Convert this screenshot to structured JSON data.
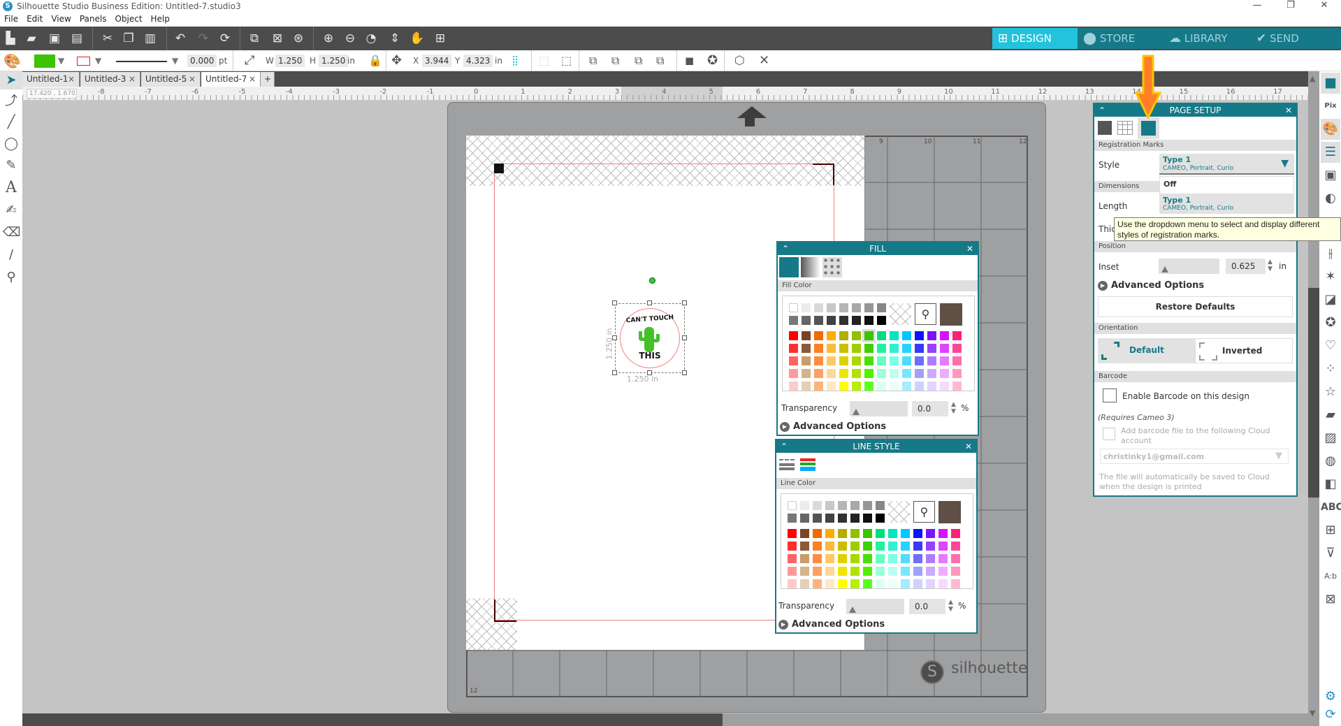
{
  "window": {
    "title": "Silhouette Studio Business Edition: Untitled-7.studio3",
    "controls": {
      "minimize": "—",
      "restore": "❐",
      "close": "✕"
    }
  },
  "menu": [
    "File",
    "Edit",
    "View",
    "Panels",
    "Object",
    "Help"
  ],
  "toolbar": {
    "icons": [
      "new-file",
      "open-folder",
      "save",
      "print",
      "cut",
      "copy",
      "paste",
      "undo",
      "redo",
      "replicate",
      "group",
      "ungroup",
      "fill-group",
      "zoom-in",
      "zoom-out",
      "zoom-select",
      "pan-drag",
      "hand",
      "fit-to-page"
    ],
    "nav_tabs": [
      {
        "label": "DESIGN",
        "icon": "grid-icon",
        "active": true
      },
      {
        "label": "STORE",
        "icon": "store-icon",
        "active": false
      },
      {
        "label": "LIBRARY",
        "icon": "cloud-download-icon",
        "active": false
      },
      {
        "label": "SEND",
        "icon": "check-icon",
        "active": false
      }
    ]
  },
  "properties_bar": {
    "fill_color": "#3cc400",
    "line_color": "#e02020",
    "line_width": "0.000",
    "line_unit": "pt",
    "width_label": "W",
    "width": "1.250",
    "height_label": "H",
    "height": "1.250",
    "size_unit": "in",
    "x_label": "X",
    "x": "3.944",
    "y_label": "Y",
    "y": "4.323",
    "pos_unit": "in"
  },
  "doc_tabs": [
    {
      "label": "Untitled-1",
      "active": false
    },
    {
      "label": "Untitled-3",
      "active": false
    },
    {
      "label": "Untitled-5",
      "active": false
    },
    {
      "label": "Untitled-7",
      "active": true
    }
  ],
  "add_tab": "+",
  "ruler": {
    "coord_readout": "17.420 , 1.670",
    "labels": [
      "-8",
      "-7",
      "-6",
      "-5",
      "-4",
      "-3",
      "-2",
      "-1",
      "0",
      "1",
      "2",
      "3",
      "4",
      "5",
      "6",
      "7",
      "8",
      "9",
      "10",
      "11",
      "12",
      "13",
      "14",
      "15",
      "16",
      "17"
    ]
  },
  "mat": {
    "grid_numbers_top": [
      "9",
      "10",
      "11",
      "12"
    ],
    "grid_number_bottom": "12",
    "brand": "silhouette"
  },
  "design": {
    "text_top": "CAN'T TOUCH",
    "text_bottom": "THIS",
    "width_dim": "1.250 in",
    "height_dim": "1.250 in"
  },
  "fill_panel": {
    "title": "FILL",
    "section": "Fill Color",
    "transparency_label": "Transparency",
    "transparency": "0.0",
    "percent": "%",
    "advanced": "Advanced Options",
    "selected_color": "#3cc400",
    "recent_color": "#5f4f44"
  },
  "line_panel": {
    "title": "LINE STYLE",
    "section": "Line Color",
    "transparency_label": "Transparency",
    "transparency": "0.0",
    "percent": "%",
    "advanced": "Advanced Options",
    "recent_color": "#5f4f44"
  },
  "palette": {
    "grays": [
      "#ffffff",
      "#ececec",
      "#dadada",
      "#c8c8c8",
      "#b6b6b6",
      "#a8a8a8",
      "#979797",
      "#878787",
      "#787878",
      "#666666",
      "#545454",
      "#424242",
      "#313131",
      "#222222",
      "#111111",
      "#000000"
    ],
    "colors": [
      [
        "#ff0000",
        "#7a4327",
        "#f56800",
        "#ffab00",
        "#b4ad00",
        "#91c000",
        "#3cc400",
        "#00dc82",
        "#00e6c0",
        "#00c8ff",
        "#0a14ff",
        "#7a14ff",
        "#d214ff",
        "#ff1e78"
      ],
      [
        "#ff2e2e",
        "#8c5a38",
        "#ff7f1e",
        "#ffb83a",
        "#cbbe00",
        "#9fcc00",
        "#40d000",
        "#22f0a0",
        "#30f0d0",
        "#28d2ff",
        "#3a3aff",
        "#9442ff",
        "#dc46ff",
        "#ff4696"
      ],
      [
        "#ff6464",
        "#c89c6e",
        "#ff8c3c",
        "#ffc864",
        "#ddd200",
        "#a8d800",
        "#48e000",
        "#64ffc0",
        "#7cffe6",
        "#50dcff",
        "#6e6eff",
        "#b07aff",
        "#e67aff",
        "#ff6eaa"
      ],
      [
        "#ff9a9a",
        "#d4b48c",
        "#ffa064",
        "#ffd896",
        "#eee600",
        "#b0e400",
        "#50f000",
        "#9cffd8",
        "#bcfff0",
        "#7ce6ff",
        "#a0a0ff",
        "#caaaff",
        "#f0aaff",
        "#ff96be"
      ],
      [
        "#ffcaca",
        "#e2d0b4",
        "#ffb47e",
        "#ffe8c8",
        "#ffff00",
        "#b4f000",
        "#5aff1e",
        "#dcfff0",
        "#eafff8",
        "#a4ecff",
        "#d0d0ff",
        "#e2d4ff",
        "#f6daff",
        "#ffb8d2"
      ]
    ]
  },
  "page_setup": {
    "title": "PAGE SETUP",
    "section_registration": "Registration Marks",
    "style_label": "Style",
    "style_value": "Type 1",
    "style_sub": "CAMEO, Portrait, Curio",
    "dropdown_options": [
      {
        "label": "Off",
        "sub": ""
      },
      {
        "label": "Type 1",
        "sub": "CAMEO, Portrait, Curio"
      }
    ],
    "dimensions_label": "Dimensions",
    "length_label": "Length",
    "thickness_label": "Thic",
    "tooltip": "Use the dropdown menu to select and display different styles of registration marks.",
    "position_label": "Position",
    "inset_label": "Inset",
    "inset_value": "0.625",
    "inset_unit": "in",
    "advanced": "Advanced Options",
    "restore": "Restore Defaults",
    "orientation_label": "Orientation",
    "orientation_default": "Default",
    "orientation_inverted": "Inverted",
    "barcode_label": "Barcode",
    "enable_barcode": "Enable Barcode on this design",
    "requires": "(Requires Cameo 3)",
    "add_barcode": "Add barcode file to the following Cloud account",
    "account": "christinky1@gmail.com",
    "cloud_note": "The file will automatically be saved to Cloud when the design is printed"
  },
  "right_panel_icons": [
    "page-setup",
    "pixscan",
    "fill",
    "line-style",
    "offset",
    "trace",
    "align",
    "transform",
    "replicate",
    "modify",
    "library-shapes",
    "design-store",
    "sketch",
    "point-edit",
    "text-style",
    "image-effects",
    "layers",
    "text",
    "warp",
    "3d",
    "text-to-path",
    "stencil",
    "settings",
    "sync"
  ],
  "accent": "#167987",
  "accent_light": "#24c3dd"
}
